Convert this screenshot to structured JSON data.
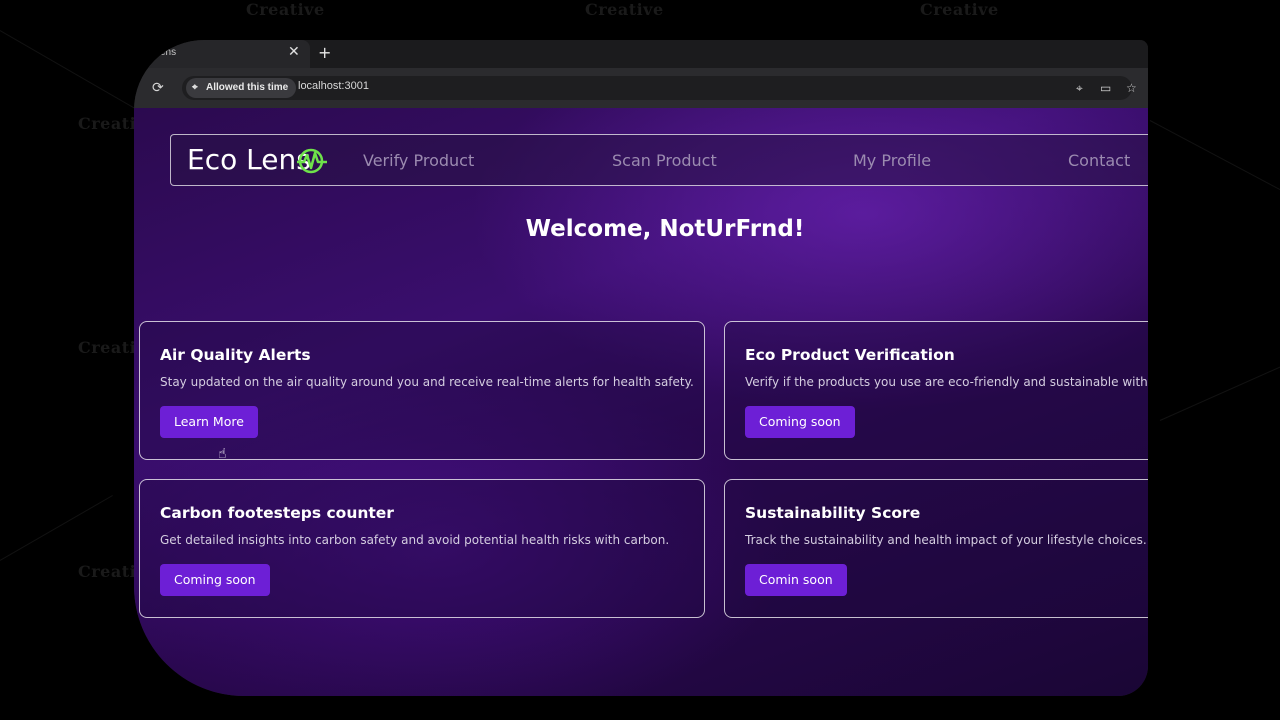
{
  "background": {
    "watermark": "Creative"
  },
  "browser": {
    "tab_title": "ens",
    "tab_close_icon": "close-icon",
    "new_tab_icon": "plus-icon",
    "permission_chip": "Allowed this time",
    "url": "localhost:3001"
  },
  "navbar": {
    "logo_text": "Eco Lens",
    "links": [
      "Verify Product",
      "Scan Product",
      "My Profile",
      "Contact"
    ]
  },
  "welcome": "Welcome, NotUrFrnd!",
  "cards": [
    {
      "title": "Air Quality Alerts",
      "description": "Stay updated on the air quality around you and receive real-time alerts for health safety.",
      "button": "Learn More"
    },
    {
      "title": "Eco Product Verification",
      "description": "Verify if the products you use are eco-friendly and sustainable with o",
      "button": "Coming soon"
    },
    {
      "title": "Carbon footesteps counter",
      "description": "Get detailed insights into carbon safety and avoid potential health risks with carbon.",
      "button": "Coming soon"
    },
    {
      "title": "Sustainability Score",
      "description": "Track the sustainability and health impact of your lifestyle choices.",
      "button": "Comin soon"
    }
  ],
  "colors": {
    "accent": "#6d1fd6",
    "logo_icon": "#6ee24a",
    "page_bg": "#2b0a4f"
  }
}
